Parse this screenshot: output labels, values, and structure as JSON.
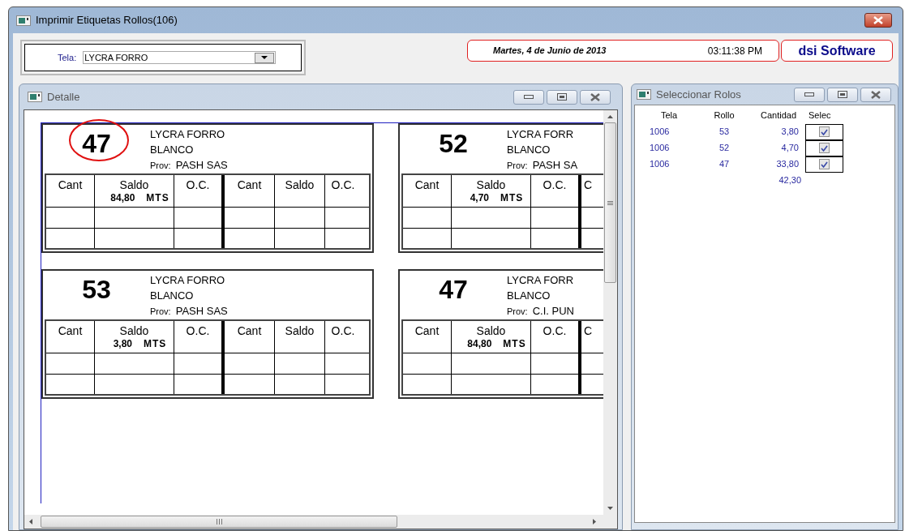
{
  "window": {
    "title": "Imprimir Etiquetas Rollos(106)"
  },
  "filter": {
    "label": "Tela:",
    "value": "LYCRA FORRO"
  },
  "date": "Martes, 4 de Junio de 2013",
  "time": "03:11:38 PM",
  "brand": "dsi Software",
  "detail": {
    "title": "Detalle",
    "labels": [
      {
        "number": "47",
        "circled": true,
        "name": "LYCRA FORRO",
        "shade": "BLANCO",
        "prov_label": "Prov:",
        "provider": "PASH SAS",
        "columns": [
          "Cant",
          "Saldo",
          "O.C.",
          "Cant",
          "Saldo",
          "O.C."
        ],
        "saldo": "84,80",
        "unit": "MTS"
      },
      {
        "number": "52",
        "circled": false,
        "name": "LYCRA FORR",
        "shade": "BLANCO",
        "prov_label": "Prov:",
        "provider": "PASH SA",
        "columns": [
          "Cant",
          "Saldo",
          "O.C.",
          "C"
        ],
        "saldo": "4,70",
        "unit": "MTS"
      },
      {
        "number": "53",
        "circled": false,
        "name": "LYCRA FORRO",
        "shade": "BLANCO",
        "prov_label": "Prov:",
        "provider": "PASH SAS",
        "columns": [
          "Cant",
          "Saldo",
          "O.C.",
          "Cant",
          "Saldo",
          "O.C."
        ],
        "saldo": "3,80",
        "unit": "MTS"
      },
      {
        "number": "47",
        "circled": false,
        "name": "LYCRA FORR",
        "shade": "BLANCO",
        "prov_label": "Prov:",
        "provider": "C.I. PUN",
        "columns": [
          "Cant",
          "Saldo",
          "O.C.",
          "C"
        ],
        "saldo": "84,80",
        "unit": "MTS"
      }
    ]
  },
  "select": {
    "title": "Seleccionar Rolos",
    "columns": [
      "Tela",
      "Rollo",
      "Cantidad",
      "Selec"
    ],
    "rows": [
      {
        "tela": "1006",
        "rollo": "53",
        "cantidad": "3,80",
        "checked": true
      },
      {
        "tela": "1006",
        "rollo": "52",
        "cantidad": "4,70",
        "checked": true
      },
      {
        "tela": "1006",
        "rollo": "47",
        "cantidad": "33,80",
        "checked": true
      }
    ],
    "total": "42,30"
  }
}
